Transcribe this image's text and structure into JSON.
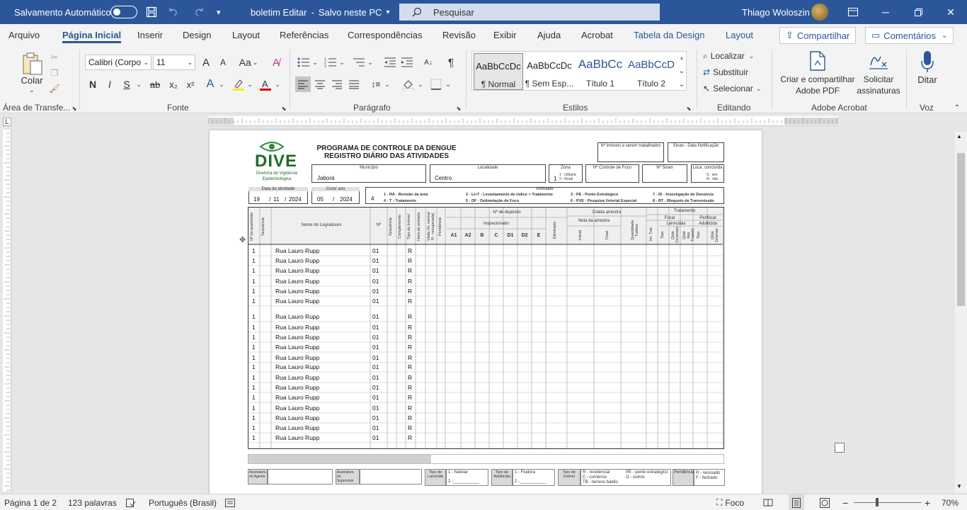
{
  "titlebar": {
    "autosave_label": "Salvamento Automático",
    "doc_title": "boletim Editar",
    "save_status": "Salvo neste PC",
    "search_placeholder": "Pesquisar",
    "user_name": "Thiago Woloszin"
  },
  "tabs": [
    "Arquivo",
    "Página Inicial",
    "Inserir",
    "Design",
    "Layout",
    "Referências",
    "Correspondências",
    "Revisão",
    "Exibir",
    "Ajuda",
    "Acrobat",
    "Tabela da Design",
    "Layout"
  ],
  "share_label": "Compartilhar",
  "comments_label": "Comentários",
  "ribbon": {
    "clipboard": {
      "paste": "Colar",
      "group": "Área de Transfe..."
    },
    "font": {
      "name": "Calibri (Corpo",
      "size": "11",
      "group": "Fonte",
      "bold": "N",
      "italic": "I",
      "underline": "S",
      "strike": "ab",
      "sub": "x₂",
      "sup": "x²",
      "case": "Aa",
      "grow": "A",
      "shrink": "A"
    },
    "paragraph": {
      "group": "Parágrafo"
    },
    "styles": {
      "group": "Estilos",
      "items": [
        {
          "sample": "AaBbCcDc",
          "name": "¶ Normal"
        },
        {
          "sample": "AaBbCcDc",
          "name": "¶ Sem Esp..."
        },
        {
          "sample": "AaBbCc",
          "name": "Título 1"
        },
        {
          "sample": "AaBbCcD",
          "name": "Título 2"
        }
      ]
    },
    "editing": {
      "find": "Localizar",
      "replace": "Substituir",
      "select": "Selecionar",
      "group": "Editando"
    },
    "acrobat": {
      "create": "Criar e compartilhar",
      "create2": "Adobe PDF",
      "sign": "Solicitar",
      "sign2": "assinaturas",
      "group": "Adobe Acrobat"
    },
    "voice": {
      "dictate": "Ditar",
      "group": "Voz"
    }
  },
  "document": {
    "logo": "DIVE",
    "logo_sub1": "Diretoria de Vigilância",
    "logo_sub2": "Epidemiológica",
    "title1": "PROGRAMA DE CONTROLE DA DENGUE",
    "title2": "REGISTRO DIÁRIO DAS ATIVIDADES",
    "imoveis_lbl": "Nº imóveis a serem trabalhados",
    "sinan_lbl": "Sinan - Data Notificação",
    "municipio_lbl": "Município",
    "municipio": "Jaborá",
    "localidade_lbl": "Localidade",
    "localidade": "Centro",
    "zona_lbl": "Zona",
    "zona": "1",
    "zona_opts1": "1 - Urbana",
    "zona_opts2": "2 - Rural",
    "controle_lbl": "Nº Controle de Foco",
    "nsinan_lbl": "Nº Sinan",
    "concluida_lbl": "Loca. concluída",
    "concluida_opts1": "S - sim",
    "concluida_opts2": "N - não",
    "data_lbl": "Data da atividade",
    "data_d": "19",
    "data_m": "11",
    "data_y": "2024",
    "ciclo_lbl": "Ciclo/ ano",
    "ciclo": "05",
    "ciclo_ano": "2024",
    "atividade_lbl": "Atividade",
    "atividade": "4",
    "ativ_1": "1 - RA - Revisão da área",
    "ativ_2": "2 - LI+T - Levantamento de índice + Tratamento",
    "ativ_3": "3 - PE - Ponto Estratégico",
    "ativ_7": "7 - ID - Investigação de Denúncia",
    "ativ_4": "4 - T - Tratamento",
    "ativ_5": "5 - DF - Delimetação de Foco",
    "ativ_6": "6 - PVE - Pesquisa Vetorial Especial",
    "ativ_8": "8 - BT - Bloqueio de Transmissão",
    "col_quarteirao": "Nº do quarteirão",
    "col_sequencia": "Sequência",
    "col_logradouro": "Nome do Logradouro",
    "col_no": "Nº",
    "col_seq2": "Sequência",
    "col_complemento": "Complemento",
    "col_tipo_imovel": "Tipo do Imóvel",
    "col_hora": "Hora de entrada",
    "col_visita": "Visita (N- normal R - recuperada)",
    "col_pendencia": "Pendência",
    "col_deposito": "Nº de depósito",
    "col_inspecionado": "Inspecionado",
    "dep_cols": [
      "A1",
      "A2",
      "B",
      "C",
      "D1",
      "D2",
      "E"
    ],
    "col_eliminado": "Eliminado",
    "col_coleta": "Coleta amostra",
    "col_nota": "Nota da amostra",
    "col_inicial": "Inicial",
    "col_final": "Final",
    "col_qtd_tubitos": "Quantidade Tubitos",
    "col_tratamento": "Tratamento",
    "col_focal": "Focal",
    "col_perifocal": "Perifocal",
    "col_larvicidas": "Larvicidas",
    "col_adulticida": "Adulticida",
    "col_im_trat": "Im. Trat.",
    "col_tipo": "Tipo",
    "col_qtde_gramas": "Qtde (Gramas)",
    "col_qtde_dep_trat": "Qtde dep. Tratado",
    "col_tipo2": "Tipo",
    "col_qtde_gramas2": "Qtde Gramas",
    "rows": [
      {
        "q": "1",
        "rua": "Rua Lauro Rupp",
        "n": "01",
        "t": "R"
      },
      {
        "q": "1",
        "rua": "Rua Lauro Rupp",
        "n": "01",
        "t": "R"
      },
      {
        "q": "1",
        "rua": "Rua Lauro Rupp",
        "n": "01",
        "t": "R"
      },
      {
        "q": "1",
        "rua": "Rua Lauro Rupp",
        "n": "01",
        "t": "R"
      },
      {
        "q": "1",
        "rua": "Rua Lauro Rupp",
        "n": "01",
        "t": "R"
      },
      {
        "q": "1",
        "rua": "Rua Lauro Rupp",
        "n": "01",
        "t": "R"
      },
      {
        "q": "1",
        "rua": "Rua Lauro Rupp",
        "n": "01",
        "t": "R"
      },
      {
        "q": "1",
        "rua": "Rua Lauro Rupp",
        "n": "01",
        "t": "R"
      },
      {
        "q": "1",
        "rua": "Rua Lauro Rupp",
        "n": "01",
        "t": "R"
      },
      {
        "q": "1",
        "rua": "Rua Lauro Rupp",
        "n": "01",
        "t": "R"
      },
      {
        "q": "1",
        "rua": "Rua Lauro Rupp",
        "n": "01",
        "t": "R"
      },
      {
        "q": "1",
        "rua": "Rua Lauro Rupp",
        "n": "01",
        "t": "R"
      },
      {
        "q": "1",
        "rua": "Rua Lauro Rupp",
        "n": "01",
        "t": "R"
      },
      {
        "q": "1",
        "rua": "Rua Lauro Rupp",
        "n": "01",
        "t": "R"
      },
      {
        "q": "1",
        "rua": "Rua Lauro Rupp",
        "n": "01",
        "t": "R"
      },
      {
        "q": "1",
        "rua": "Rua Lauro Rupp",
        "n": "01",
        "t": "R"
      },
      {
        "q": "1",
        "rua": "Rua Lauro Rupp",
        "n": "01",
        "t": "R"
      },
      {
        "q": "1",
        "rua": "Rua Lauro Rupp",
        "n": "01",
        "t": "R"
      },
      {
        "q": "1",
        "rua": "Rua Lauro Rupp",
        "n": "01",
        "t": "R"
      }
    ],
    "foot_agente": "Assinatura do Agente",
    "foot_supervisor": "Assinatura do Supervisor",
    "foot_larvicida": "Tipo de Larvicida",
    "foot_larv_1": "1 - Natular",
    "foot_larv_2": "2 -___________",
    "foot_adulticida": "Tipo de Adulticida",
    "foot_adul_1": "1 - Fludora",
    "foot_adul_2": "2 -___________",
    "foot_imovel": "Tipo do imóvel",
    "foot_im_r": "R - residencial",
    "foot_im_c": "C - comércio",
    "foot_im_tb": "TB - terreno baldio",
    "foot_im_pe": "PE - ponto estratégico",
    "foot_im_o": "O - outros",
    "foot_pendencia": "Pendência",
    "foot_pend_r": "R - recusado",
    "foot_pend_f": "F - fechado"
  },
  "status": {
    "page": "Página 1 de 2",
    "words": "123 palavras",
    "lang": "Português (Brasil)",
    "focus": "Foco",
    "zoom": "70%"
  },
  "colors": {
    "accent": "#2b579a"
  }
}
